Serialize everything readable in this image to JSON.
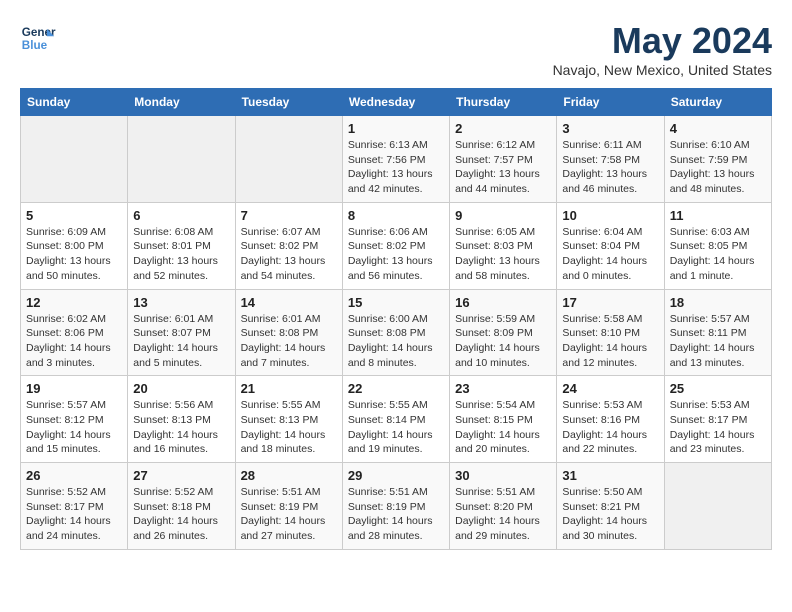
{
  "header": {
    "logo_line1": "General",
    "logo_line2": "Blue",
    "title": "May 2024",
    "subtitle": "Navajo, New Mexico, United States"
  },
  "weekdays": [
    "Sunday",
    "Monday",
    "Tuesday",
    "Wednesday",
    "Thursday",
    "Friday",
    "Saturday"
  ],
  "weeks": [
    [
      {
        "day": "",
        "info": ""
      },
      {
        "day": "",
        "info": ""
      },
      {
        "day": "",
        "info": ""
      },
      {
        "day": "1",
        "info": "Sunrise: 6:13 AM\nSunset: 7:56 PM\nDaylight: 13 hours\nand 42 minutes."
      },
      {
        "day": "2",
        "info": "Sunrise: 6:12 AM\nSunset: 7:57 PM\nDaylight: 13 hours\nand 44 minutes."
      },
      {
        "day": "3",
        "info": "Sunrise: 6:11 AM\nSunset: 7:58 PM\nDaylight: 13 hours\nand 46 minutes."
      },
      {
        "day": "4",
        "info": "Sunrise: 6:10 AM\nSunset: 7:59 PM\nDaylight: 13 hours\nand 48 minutes."
      }
    ],
    [
      {
        "day": "5",
        "info": "Sunrise: 6:09 AM\nSunset: 8:00 PM\nDaylight: 13 hours\nand 50 minutes."
      },
      {
        "day": "6",
        "info": "Sunrise: 6:08 AM\nSunset: 8:01 PM\nDaylight: 13 hours\nand 52 minutes."
      },
      {
        "day": "7",
        "info": "Sunrise: 6:07 AM\nSunset: 8:02 PM\nDaylight: 13 hours\nand 54 minutes."
      },
      {
        "day": "8",
        "info": "Sunrise: 6:06 AM\nSunset: 8:02 PM\nDaylight: 13 hours\nand 56 minutes."
      },
      {
        "day": "9",
        "info": "Sunrise: 6:05 AM\nSunset: 8:03 PM\nDaylight: 13 hours\nand 58 minutes."
      },
      {
        "day": "10",
        "info": "Sunrise: 6:04 AM\nSunset: 8:04 PM\nDaylight: 14 hours\nand 0 minutes."
      },
      {
        "day": "11",
        "info": "Sunrise: 6:03 AM\nSunset: 8:05 PM\nDaylight: 14 hours\nand 1 minute."
      }
    ],
    [
      {
        "day": "12",
        "info": "Sunrise: 6:02 AM\nSunset: 8:06 PM\nDaylight: 14 hours\nand 3 minutes."
      },
      {
        "day": "13",
        "info": "Sunrise: 6:01 AM\nSunset: 8:07 PM\nDaylight: 14 hours\nand 5 minutes."
      },
      {
        "day": "14",
        "info": "Sunrise: 6:01 AM\nSunset: 8:08 PM\nDaylight: 14 hours\nand 7 minutes."
      },
      {
        "day": "15",
        "info": "Sunrise: 6:00 AM\nSunset: 8:08 PM\nDaylight: 14 hours\nand 8 minutes."
      },
      {
        "day": "16",
        "info": "Sunrise: 5:59 AM\nSunset: 8:09 PM\nDaylight: 14 hours\nand 10 minutes."
      },
      {
        "day": "17",
        "info": "Sunrise: 5:58 AM\nSunset: 8:10 PM\nDaylight: 14 hours\nand 12 minutes."
      },
      {
        "day": "18",
        "info": "Sunrise: 5:57 AM\nSunset: 8:11 PM\nDaylight: 14 hours\nand 13 minutes."
      }
    ],
    [
      {
        "day": "19",
        "info": "Sunrise: 5:57 AM\nSunset: 8:12 PM\nDaylight: 14 hours\nand 15 minutes."
      },
      {
        "day": "20",
        "info": "Sunrise: 5:56 AM\nSunset: 8:13 PM\nDaylight: 14 hours\nand 16 minutes."
      },
      {
        "day": "21",
        "info": "Sunrise: 5:55 AM\nSunset: 8:13 PM\nDaylight: 14 hours\nand 18 minutes."
      },
      {
        "day": "22",
        "info": "Sunrise: 5:55 AM\nSunset: 8:14 PM\nDaylight: 14 hours\nand 19 minutes."
      },
      {
        "day": "23",
        "info": "Sunrise: 5:54 AM\nSunset: 8:15 PM\nDaylight: 14 hours\nand 20 minutes."
      },
      {
        "day": "24",
        "info": "Sunrise: 5:53 AM\nSunset: 8:16 PM\nDaylight: 14 hours\nand 22 minutes."
      },
      {
        "day": "25",
        "info": "Sunrise: 5:53 AM\nSunset: 8:17 PM\nDaylight: 14 hours\nand 23 minutes."
      }
    ],
    [
      {
        "day": "26",
        "info": "Sunrise: 5:52 AM\nSunset: 8:17 PM\nDaylight: 14 hours\nand 24 minutes."
      },
      {
        "day": "27",
        "info": "Sunrise: 5:52 AM\nSunset: 8:18 PM\nDaylight: 14 hours\nand 26 minutes."
      },
      {
        "day": "28",
        "info": "Sunrise: 5:51 AM\nSunset: 8:19 PM\nDaylight: 14 hours\nand 27 minutes."
      },
      {
        "day": "29",
        "info": "Sunrise: 5:51 AM\nSunset: 8:19 PM\nDaylight: 14 hours\nand 28 minutes."
      },
      {
        "day": "30",
        "info": "Sunrise: 5:51 AM\nSunset: 8:20 PM\nDaylight: 14 hours\nand 29 minutes."
      },
      {
        "day": "31",
        "info": "Sunrise: 5:50 AM\nSunset: 8:21 PM\nDaylight: 14 hours\nand 30 minutes."
      },
      {
        "day": "",
        "info": ""
      }
    ]
  ]
}
